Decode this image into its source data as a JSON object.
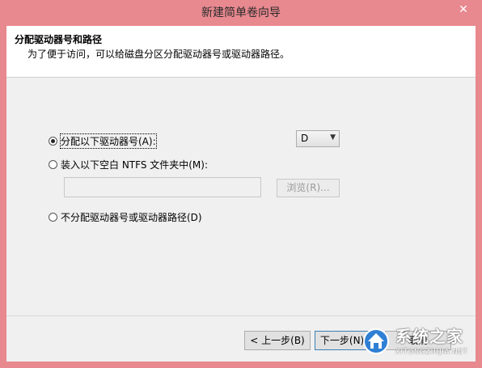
{
  "window": {
    "title": "新建简单卷向导",
    "close_label": "✕"
  },
  "header": {
    "title": "分配驱动器号和路径",
    "subtitle": "为了便于访问，可以给磁盘分区分配驱动器号或驱动器路径。"
  },
  "options": {
    "assign_letter": {
      "label": "分配以下驱动器号(A):",
      "checked": true
    },
    "mount_folder": {
      "label": "装入以下空白 NTFS 文件夹中(M):",
      "checked": false
    },
    "no_assign": {
      "label": "不分配驱动器号或驱动器路径(D)",
      "checked": false
    }
  },
  "drive_letter": {
    "value": "D",
    "arrow_icon": "chevron-down-icon"
  },
  "folder_path": {
    "value": ""
  },
  "buttons": {
    "browse": "浏览(R)...",
    "back": "< 上一步(B)",
    "next": "下一步(N) >",
    "cancel": "取消"
  },
  "watermark": {
    "text": "系统之家",
    "url": "XITONGZHIJIA.NET"
  }
}
